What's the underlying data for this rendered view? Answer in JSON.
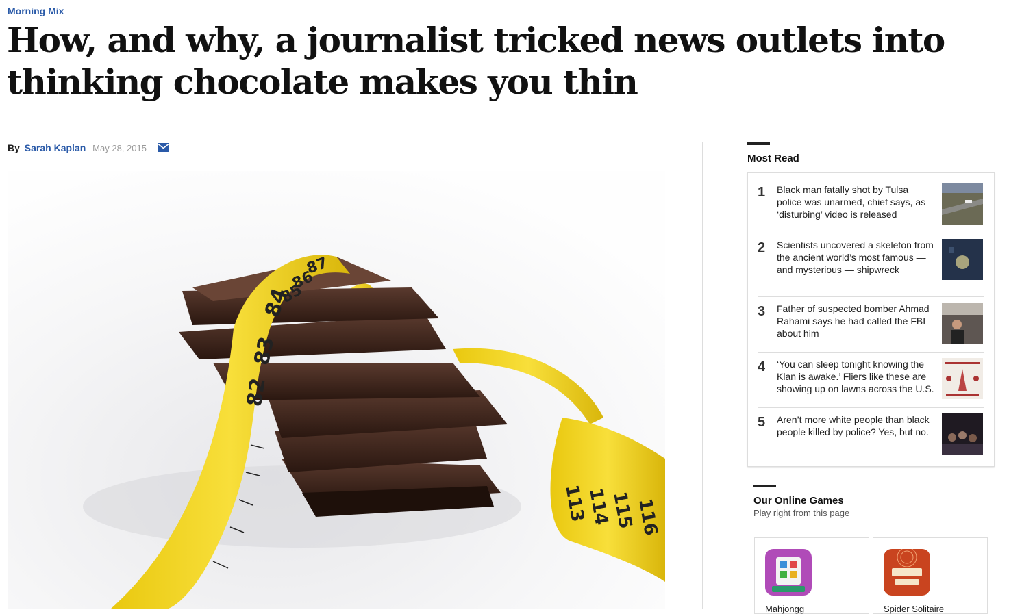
{
  "article": {
    "kicker": "Morning Mix",
    "headline": "How, and why, a journalist tricked news outlets into thinking chocolate makes you thin",
    "byline_prefix": "By",
    "author": "Sarah Kaplan",
    "date": "May 28, 2015",
    "hero_image": "chocolate-and-tape-measure-photo",
    "tape_numbers": [
      "87",
      "86",
      "85",
      "84",
      "83",
      "82",
      "113",
      "114",
      "115",
      "116"
    ]
  },
  "sidebar": {
    "most_read": {
      "title": "Most Read",
      "items": [
        {
          "rank": "1",
          "text": "Black man fatally shot by Tulsa police was unarmed, chief says, as ‘disturbing’ video is released",
          "thumb": "tulsa-aerial-thumb"
        },
        {
          "rank": "2",
          "text": "Scientists uncovered a skeleton from the ancient world’s most famous — and mysterious — shipwreck",
          "thumb": "shipwreck-thumb"
        },
        {
          "rank": "3",
          "text": "Father of suspected bomber Ahmad Rahami says he had called the FBI about him",
          "thumb": "rahami-thumb"
        },
        {
          "rank": "4",
          "text": "‘You can sleep tonight knowing the Klan is awake.’ Fliers like these are showing up on lawns across the U.S.",
          "thumb": "klan-flier-thumb"
        },
        {
          "rank": "5",
          "text": "Aren’t more white people than black people killed by police? Yes, but no.",
          "thumb": "protest-thumb"
        }
      ]
    },
    "games": {
      "title": "Our Online Games",
      "subtitle": "Play right from this page",
      "cards": [
        {
          "label": "Mahjongg",
          "icon": "mahjongg-icon"
        },
        {
          "label": "Spider Solitaire",
          "icon": "spider-solitaire-icon"
        }
      ]
    }
  },
  "colors": {
    "link": "#2a5aa8",
    "tape": "#f2d21e",
    "chocolate": "#3a221a"
  }
}
